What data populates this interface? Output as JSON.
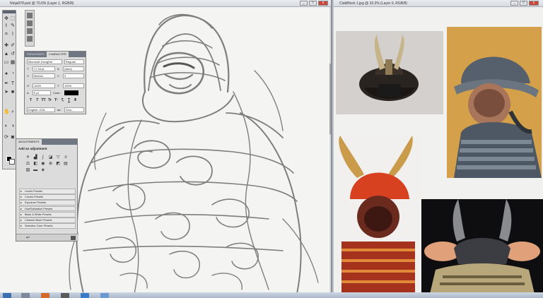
{
  "photoshop_window": {
    "title": "Ninja978.psd @ 70.6% (Layer 1, RGB/8)",
    "controls": {
      "minimize": "_",
      "maximize": "□",
      "close": "x"
    }
  },
  "reference_window": {
    "title": "ClubBlock 1.jpg @ 33.3% (Layer 0, RGB/8)",
    "controls": {
      "minimize": "_",
      "maximize": "□",
      "close": "x"
    }
  },
  "toolbox": {
    "tools": [
      "move-tool",
      "marquee-tool",
      "lasso-tool",
      "quick-select-tool",
      "crop-tool",
      "eyedropper-tool",
      "healing-tool",
      "brush-tool",
      "clone-stamp-tool",
      "history-brush-tool",
      "eraser-tool",
      "gradient-tool",
      "blur-tool",
      "dodge-tool",
      "pen-tool",
      "type-tool",
      "path-select-tool",
      "shape-tool",
      "hand-tool",
      "zoom-tool"
    ],
    "foreground_color": "#000000",
    "background_color": "#ffffff"
  },
  "character_panel": {
    "tabs": [
      "PARAGRAPH",
      "CHARACTER"
    ],
    "active_tab": "CHARACTER",
    "font_family": "Microsoft JhengHei",
    "font_style": "Regular",
    "font_size": "17.33 pt",
    "leading": "(Auto)",
    "kerning": "Metrics",
    "tracking": "0",
    "vertical_scale": "100%",
    "horizontal_scale": "100%",
    "baseline_shift": "0 pt",
    "color_label": "Color:",
    "style_buttons": [
      "T",
      "T",
      "TT",
      "Tr",
      "T¹",
      "T,",
      "T",
      "T"
    ],
    "language": "English: USA",
    "antialias": "Smo..."
  },
  "adjustments_panel": {
    "tab": "ADJUSTMENTS",
    "title": "Add an adjustment",
    "presets": [
      "Levels Presets",
      "Curves Presets",
      "Exposure Presets",
      "Hue/Saturation Presets",
      "Black & White Presets",
      "Channel Mixer Presets",
      "Selective Color Presets"
    ]
  },
  "colors": {
    "canvas": "#f4f4f2",
    "sketch_stroke": "#6a6a6a",
    "chrome": "#d9dbde"
  }
}
